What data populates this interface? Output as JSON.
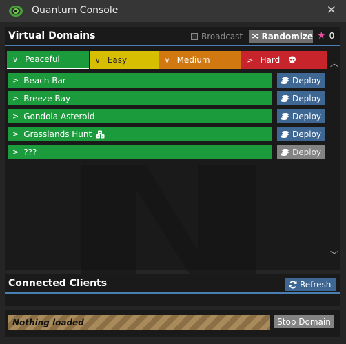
{
  "window": {
    "title": "Quantum Console",
    "icon": "eye-icon",
    "close_glyph": "✕"
  },
  "domains_section": {
    "heading": "Virtual Domains",
    "broadcast_label": "Broadcast",
    "broadcast_checked": false,
    "randomize_label": "Randomize",
    "stars_count": "0",
    "star_color": "#e84ea1",
    "tabs": [
      {
        "label": "Peaceful",
        "color": "#1b9b3c",
        "selected": true
      },
      {
        "label": "Easy",
        "color": "#d8be00",
        "selected": false
      },
      {
        "label": "Medium",
        "color": "#d27810",
        "selected": false
      },
      {
        "label": "Hard",
        "color": "#c8242c",
        "selected": false
      }
    ],
    "domains": [
      {
        "name": "Beach Bar",
        "deploy_label": "Deploy",
        "deploy_enabled": true
      },
      {
        "name": "Breeze Bay",
        "deploy_label": "Deploy",
        "deploy_enabled": true
      },
      {
        "name": "Gondola Asteroid",
        "deploy_label": "Deploy",
        "deploy_enabled": true
      },
      {
        "name": "Grasslands Hunt",
        "deploy_label": "Deploy",
        "deploy_enabled": true,
        "extra_icon": "dice-icon"
      },
      {
        "name": "???",
        "deploy_label": "Deploy",
        "deploy_enabled": false
      }
    ]
  },
  "clients_section": {
    "heading": "Connected Clients",
    "refresh_label": "Refresh"
  },
  "status": {
    "loaded_text": "Nothing loaded",
    "stop_label": "Stop Domain"
  },
  "colors": {
    "accent_blue": "#3f6794",
    "divider_blue": "#4a7fb3",
    "green": "#1b9b3c",
    "disabled_gray": "#838383"
  }
}
